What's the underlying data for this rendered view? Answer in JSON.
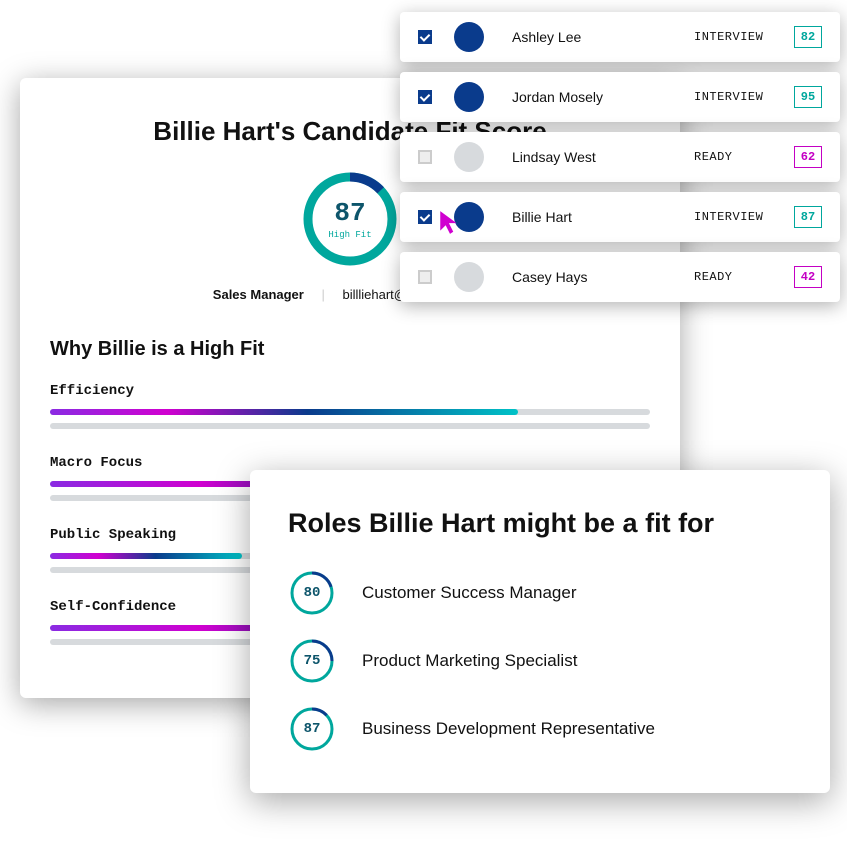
{
  "profile": {
    "title": "Billie Hart's Candidate Fit Score",
    "score": 87,
    "score_label": "High Fit",
    "role": "Sales Manager",
    "email": "billliehart@applicant.com",
    "why_heading": "Why Billie is a High Fit",
    "traits": [
      {
        "label": "Efficiency",
        "pct1": 78,
        "pct2": 100
      },
      {
        "label": "Macro Focus",
        "pct1": 100,
        "pct2": 100
      },
      {
        "label": "Public Speaking",
        "pct1": 32,
        "pct2": 100
      },
      {
        "label": "Self-Confidence",
        "pct1": 100,
        "pct2": 60
      }
    ]
  },
  "candidates": [
    {
      "name": "Ashley Lee",
      "status": "INTERVIEW",
      "score": 82,
      "checked": true,
      "score_style": "teal"
    },
    {
      "name": "Jordan Mosely",
      "status": "INTERVIEW",
      "score": 95,
      "checked": true,
      "score_style": "teal"
    },
    {
      "name": "Lindsay West",
      "status": "READY",
      "score": 62,
      "checked": false,
      "score_style": "magenta"
    },
    {
      "name": "Billie Hart",
      "status": "INTERVIEW",
      "score": 87,
      "checked": true,
      "score_style": "teal"
    },
    {
      "name": "Casey Hays",
      "status": "READY",
      "score": 42,
      "checked": false,
      "score_style": "magenta"
    }
  ],
  "roles": {
    "title": "Roles Billie Hart might be a fit for",
    "items": [
      {
        "score": 80,
        "name": "Customer Success Manager"
      },
      {
        "score": 75,
        "name": "Product Marketing Specialist"
      },
      {
        "score": 87,
        "name": "Business Development Representative"
      }
    ]
  },
  "colors": {
    "teal": "#00a79d",
    "navy": "#0a3b8c",
    "magenta": "#c400c4"
  }
}
